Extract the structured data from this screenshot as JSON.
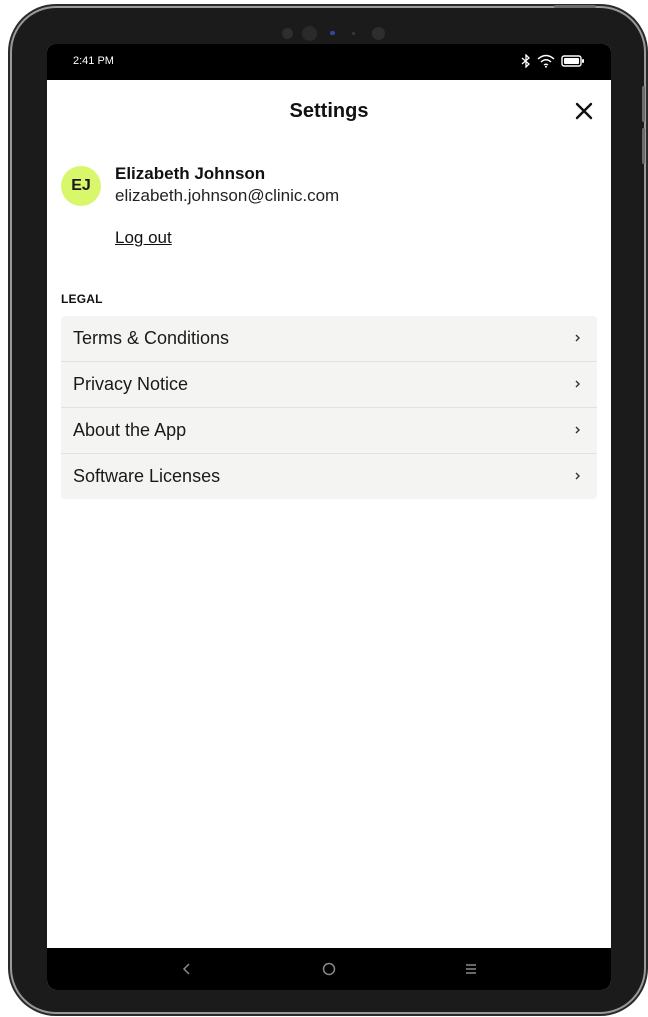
{
  "status_bar": {
    "time": "2:41 PM",
    "icons": [
      "bluetooth-icon",
      "wifi-icon",
      "battery-icon"
    ]
  },
  "header": {
    "title": "Settings",
    "close_icon": "close-icon"
  },
  "profile": {
    "initials": "EJ",
    "name": "Elizabeth Johnson",
    "email": "elizabeth.johnson@clinic.com",
    "logout_label": "Log out"
  },
  "legal": {
    "section_label": "LEGAL",
    "items": [
      {
        "label": "Terms & Conditions"
      },
      {
        "label": "Privacy Notice"
      },
      {
        "label": "About the App"
      },
      {
        "label": "Software Licenses"
      }
    ]
  },
  "navigation": {
    "buttons": [
      "back-icon",
      "home-icon",
      "menu-icon"
    ]
  },
  "colors": {
    "avatar_bg": "#d9f76a",
    "list_bg": "#f4f4f3",
    "bars": "#000000"
  }
}
